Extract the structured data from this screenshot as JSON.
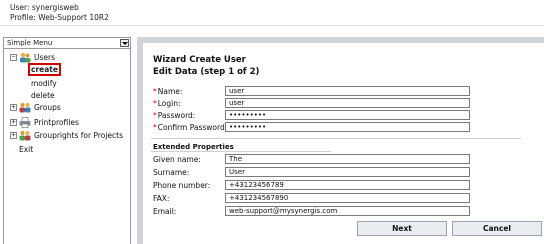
{
  "header": {
    "user_line": "User: synergisweb",
    "profile_line": "Profile: Web-Support 10R2"
  },
  "menu": {
    "selected": "Simple Menu",
    "tree": [
      {
        "label": "Users",
        "expanded": true,
        "icon": "users-icon",
        "children": [
          {
            "label": "create",
            "active": true
          },
          {
            "label": "modify"
          },
          {
            "label": "delete"
          }
        ]
      },
      {
        "label": "Groups",
        "expanded": false,
        "icon": "groups-icon"
      },
      {
        "label": "Printprofiles",
        "expanded": false,
        "icon": "printprofiles-icon"
      },
      {
        "label": "Grouprights for Projects",
        "expanded": false,
        "icon": "grouprights-icon"
      }
    ],
    "exit_label": "Exit"
  },
  "wizard": {
    "title": "Wizard Create User",
    "subtitle": "Edit Data (step 1 of 2)",
    "required_fields": [
      {
        "label": "Name:",
        "value": "user"
      },
      {
        "label": "Login:",
        "value": "user"
      },
      {
        "label": "Password:",
        "value": "•••••••••"
      },
      {
        "label": "Confirm Password:",
        "value": "•••••••••"
      }
    ],
    "extended_title": "Extended Properties",
    "extended_fields": [
      {
        "label": "Given name:",
        "value": "The"
      },
      {
        "label": "Surname:",
        "value": "User"
      },
      {
        "label": "Phone number:",
        "value": "+43123456789"
      },
      {
        "label": "FAX:",
        "value": "+431234567890"
      },
      {
        "label": "Email:",
        "value": "web-support@mysynergis.com"
      }
    ],
    "next_label": "Next",
    "cancel_label": "Cancel"
  },
  "colors": {
    "required_marker": "#d00000",
    "active_outline": "#d00000",
    "content_frame": "#cfd4da",
    "button_bg": "#e9edf1"
  }
}
